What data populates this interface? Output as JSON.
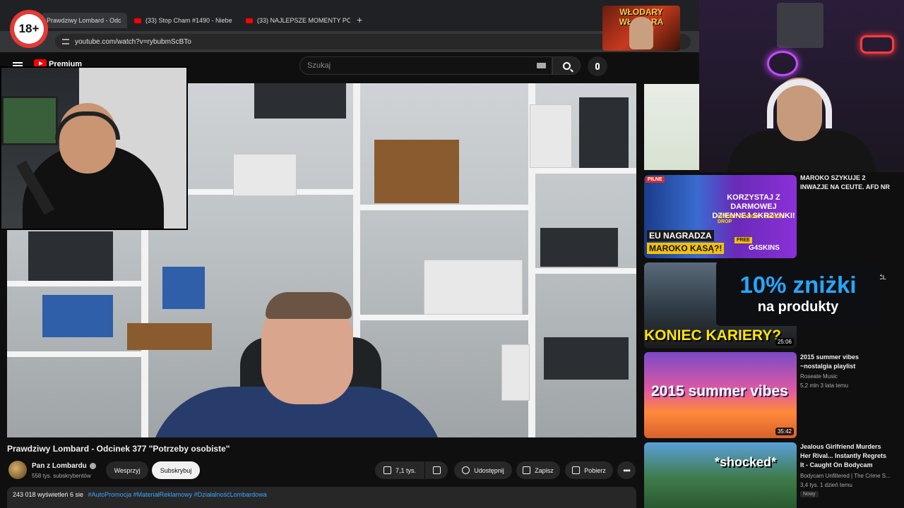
{
  "browser": {
    "tabs": [
      {
        "label": "Prawdziwy Lombard - Odc"
      },
      {
        "label": "(33) Stop Cham #1490 - Niebe"
      },
      {
        "label": "(33) NAJLEPSZE MOMENTY PO"
      }
    ],
    "new_tab": "+",
    "url": "youtube.com/watch?v=rybubmScBTo"
  },
  "age_badge": "18+",
  "overlay_badge": "WŁODARY WŁODARA",
  "youtube": {
    "logo_text": "Premium",
    "search_placeholder": "Szukaj"
  },
  "video": {
    "title": "Prawdziwy Lombard - Odcinek 377 \"Potrzeby osobiste\"",
    "channel": "Pan z Lombardu",
    "subscribers": "558 tys. subskrybentów",
    "support_label": "Wesprzyj",
    "subscribe_label": "Subskrybuj",
    "likes": "7,1 tys.",
    "share_label": "Udostępnij",
    "save_label": "Zapisz",
    "download_label": "Pobierz",
    "more_label": "•••",
    "views": "243 018 wyświetleń  6 sie",
    "tags": "#AutoPromocja #MateriałReklamowy #DziałalnośćLombardowa"
  },
  "sidebar": [
    {
      "title": "MAROKO SZYKUJE 2 INWAZJE NA CEUTE. AFD NR",
      "thumb_text1": "EU NAGRADZA",
      "thumb_text2": "MAROKO KASĄ?!",
      "ad_line1": "KORZYSTAJ Z DARMOWEJ",
      "ad_line2": "DZIENNEJ SKRZYNKI!",
      "ad_line3": "WYŻSZY POZIOM = LEPSZY DROP",
      "ad_brand": "G4SKINS",
      "ad_free": "FREE",
      "pill": "PILNE"
    },
    {
      "title": "",
      "thumb_text": "KONIEC KARIERY?",
      "duration": "25:06",
      "side_fragment": "ĆL"
    },
    {
      "title": "2015 summer vibes ~nostalgia playlist",
      "channel": "Roseate Music",
      "meta": "5,2 mln   3 lata temu",
      "thumb_text": "2015 summer vibes",
      "duration": "35:42"
    },
    {
      "title": "Jealous Girlfriend Murders Her Rival... Instantly Regrets It - Caught On Bodycam",
      "channel": "Bodycam Unfiltered | The Crime S...",
      "meta": "3,4 tys.   1 dzień temu",
      "badge": "Nowy",
      "thumb_text": "*shocked*"
    }
  ],
  "promo": {
    "line1": "10% zniżki",
    "line2": "na produkty"
  }
}
